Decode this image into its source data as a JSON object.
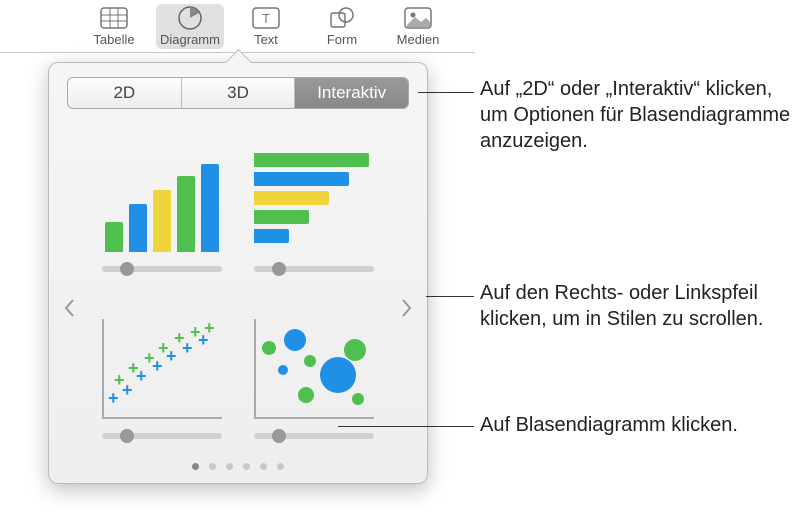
{
  "toolbar": {
    "items": [
      {
        "label": "Tabelle",
        "icon": "table-icon"
      },
      {
        "label": "Diagramm",
        "icon": "chart-icon",
        "active": true
      },
      {
        "label": "Text",
        "icon": "text-icon"
      },
      {
        "label": "Form",
        "icon": "shape-icon"
      },
      {
        "label": "Medien",
        "icon": "media-icon"
      }
    ]
  },
  "popover": {
    "tabs": {
      "tab1": "2D",
      "tab2": "3D",
      "tab3": "Interaktiv",
      "selected": "Interaktiv"
    },
    "options": [
      {
        "name": "vertical-bar-chart"
      },
      {
        "name": "horizontal-bar-chart"
      },
      {
        "name": "scatter-chart"
      },
      {
        "name": "bubble-chart"
      }
    ],
    "page_count": 6,
    "active_page": 0
  },
  "callouts": {
    "c1": "Auf „2D“ oder „Interaktiv“ klicken, um Optionen für Blasendiagramme anzuzeigen.",
    "c2": "Auf den Rechts- oder Linkspfeil klicken, um in Stilen zu scrollen.",
    "c3": "Auf Blasendiagramm klicken."
  },
  "colors": {
    "green": "#4fbf4f",
    "blue": "#1f90e6",
    "yellow": "#f0d43c"
  }
}
